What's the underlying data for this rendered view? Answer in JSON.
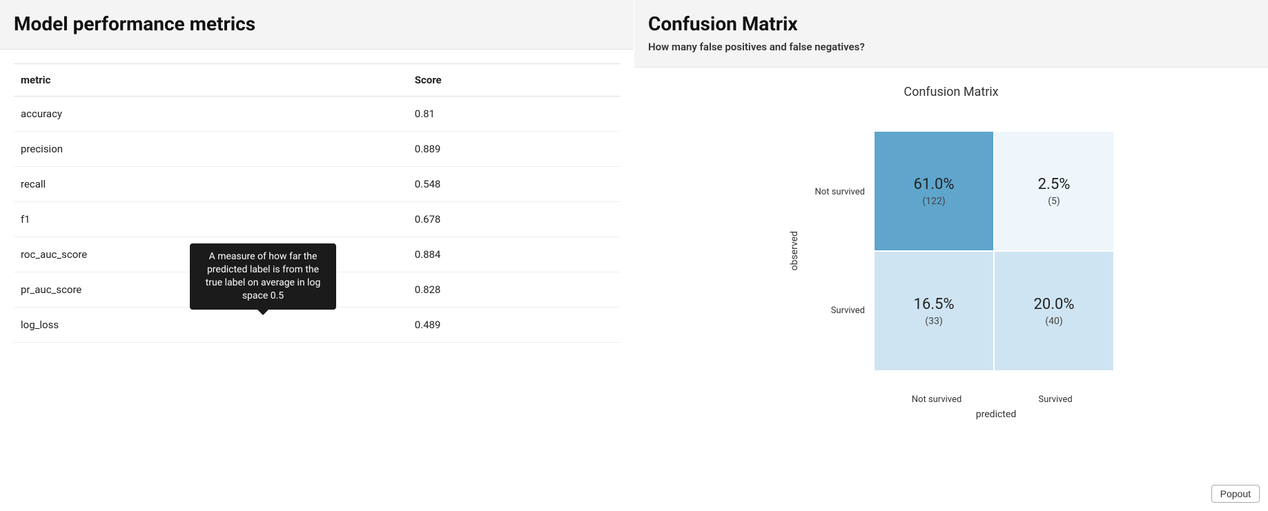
{
  "left": {
    "title": "Model performance metrics",
    "columns": {
      "metric": "metric",
      "score": "Score"
    },
    "rows": [
      {
        "metric": "accuracy",
        "score": "0.81"
      },
      {
        "metric": "precision",
        "score": "0.889"
      },
      {
        "metric": "recall",
        "score": "0.548"
      },
      {
        "metric": "f1",
        "score": "0.678"
      },
      {
        "metric": "roc_auc_score",
        "score": "0.884"
      },
      {
        "metric": "pr_auc_score",
        "score": "0.828"
      },
      {
        "metric": "log_loss",
        "score": "0.489"
      }
    ],
    "tooltip": "A measure of how far the predicted label is from the true label on average in log space 0.5"
  },
  "right": {
    "title": "Confusion Matrix",
    "subtitle": "How many false positives and false negatives?",
    "plot_title": "Confusion Matrix",
    "ylabel": "observed",
    "xlabel": "predicted",
    "row_labels": [
      "Not survived",
      "Survived"
    ],
    "col_labels": [
      "Not survived",
      "Survived"
    ],
    "cells": [
      {
        "pct": "61.0%",
        "count": "(122)"
      },
      {
        "pct": "2.5%",
        "count": "(5)"
      },
      {
        "pct": "16.5%",
        "count": "(33)"
      },
      {
        "pct": "20.0%",
        "count": "(40)"
      }
    ],
    "popout": "Popout"
  },
  "chart_data": {
    "type": "heatmap",
    "title": "Confusion Matrix",
    "xlabel": "predicted",
    "ylabel": "observed",
    "x_categories": [
      "Not survived",
      "Survived"
    ],
    "y_categories": [
      "Not survived",
      "Survived"
    ],
    "percent": [
      [
        61.0,
        2.5
      ],
      [
        16.5,
        20.0
      ]
    ],
    "count": [
      [
        122,
        5
      ],
      [
        33,
        40
      ]
    ]
  }
}
